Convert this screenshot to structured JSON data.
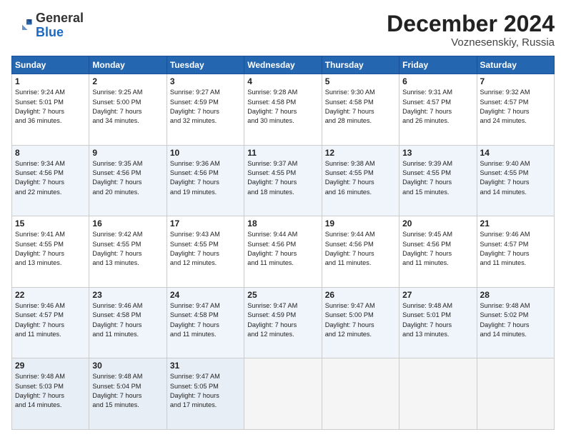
{
  "header": {
    "logo": {
      "general": "General",
      "blue": "Blue"
    },
    "title": "December 2024",
    "subtitle": "Voznesenskiy, Russia"
  },
  "weekdays": [
    "Sunday",
    "Monday",
    "Tuesday",
    "Wednesday",
    "Thursday",
    "Friday",
    "Saturday"
  ],
  "weeks": [
    [
      {
        "day": "1",
        "sunrise": "9:24 AM",
        "sunset": "5:01 PM",
        "daylight": "7 hours and 36 minutes."
      },
      {
        "day": "2",
        "sunrise": "9:25 AM",
        "sunset": "5:00 PM",
        "daylight": "7 hours and 34 minutes."
      },
      {
        "day": "3",
        "sunrise": "9:27 AM",
        "sunset": "4:59 PM",
        "daylight": "7 hours and 32 minutes."
      },
      {
        "day": "4",
        "sunrise": "9:28 AM",
        "sunset": "4:58 PM",
        "daylight": "7 hours and 30 minutes."
      },
      {
        "day": "5",
        "sunrise": "9:30 AM",
        "sunset": "4:58 PM",
        "daylight": "7 hours and 28 minutes."
      },
      {
        "day": "6",
        "sunrise": "9:31 AM",
        "sunset": "4:57 PM",
        "daylight": "7 hours and 26 minutes."
      },
      {
        "day": "7",
        "sunrise": "9:32 AM",
        "sunset": "4:57 PM",
        "daylight": "7 hours and 24 minutes."
      }
    ],
    [
      {
        "day": "8",
        "sunrise": "9:34 AM",
        "sunset": "4:56 PM",
        "daylight": "7 hours and 22 minutes."
      },
      {
        "day": "9",
        "sunrise": "9:35 AM",
        "sunset": "4:56 PM",
        "daylight": "7 hours and 20 minutes."
      },
      {
        "day": "10",
        "sunrise": "9:36 AM",
        "sunset": "4:56 PM",
        "daylight": "7 hours and 19 minutes."
      },
      {
        "day": "11",
        "sunrise": "9:37 AM",
        "sunset": "4:55 PM",
        "daylight": "7 hours and 18 minutes."
      },
      {
        "day": "12",
        "sunrise": "9:38 AM",
        "sunset": "4:55 PM",
        "daylight": "7 hours and 16 minutes."
      },
      {
        "day": "13",
        "sunrise": "9:39 AM",
        "sunset": "4:55 PM",
        "daylight": "7 hours and 15 minutes."
      },
      {
        "day": "14",
        "sunrise": "9:40 AM",
        "sunset": "4:55 PM",
        "daylight": "7 hours and 14 minutes."
      }
    ],
    [
      {
        "day": "15",
        "sunrise": "9:41 AM",
        "sunset": "4:55 PM",
        "daylight": "7 hours and 13 minutes."
      },
      {
        "day": "16",
        "sunrise": "9:42 AM",
        "sunset": "4:55 PM",
        "daylight": "7 hours and 13 minutes."
      },
      {
        "day": "17",
        "sunrise": "9:43 AM",
        "sunset": "4:55 PM",
        "daylight": "7 hours and 12 minutes."
      },
      {
        "day": "18",
        "sunrise": "9:44 AM",
        "sunset": "4:56 PM",
        "daylight": "7 hours and 11 minutes."
      },
      {
        "day": "19",
        "sunrise": "9:44 AM",
        "sunset": "4:56 PM",
        "daylight": "7 hours and 11 minutes."
      },
      {
        "day": "20",
        "sunrise": "9:45 AM",
        "sunset": "4:56 PM",
        "daylight": "7 hours and 11 minutes."
      },
      {
        "day": "21",
        "sunrise": "9:46 AM",
        "sunset": "4:57 PM",
        "daylight": "7 hours and 11 minutes."
      }
    ],
    [
      {
        "day": "22",
        "sunrise": "9:46 AM",
        "sunset": "4:57 PM",
        "daylight": "7 hours and 11 minutes."
      },
      {
        "day": "23",
        "sunrise": "9:46 AM",
        "sunset": "4:58 PM",
        "daylight": "7 hours and 11 minutes."
      },
      {
        "day": "24",
        "sunrise": "9:47 AM",
        "sunset": "4:58 PM",
        "daylight": "7 hours and 11 minutes."
      },
      {
        "day": "25",
        "sunrise": "9:47 AM",
        "sunset": "4:59 PM",
        "daylight": "7 hours and 12 minutes."
      },
      {
        "day": "26",
        "sunrise": "9:47 AM",
        "sunset": "5:00 PM",
        "daylight": "7 hours and 12 minutes."
      },
      {
        "day": "27",
        "sunrise": "9:48 AM",
        "sunset": "5:01 PM",
        "daylight": "7 hours and 13 minutes."
      },
      {
        "day": "28",
        "sunrise": "9:48 AM",
        "sunset": "5:02 PM",
        "daylight": "7 hours and 14 minutes."
      }
    ],
    [
      {
        "day": "29",
        "sunrise": "9:48 AM",
        "sunset": "5:03 PM",
        "daylight": "7 hours and 14 minutes."
      },
      {
        "day": "30",
        "sunrise": "9:48 AM",
        "sunset": "5:04 PM",
        "daylight": "7 hours and 15 minutes."
      },
      {
        "day": "31",
        "sunrise": "9:47 AM",
        "sunset": "5:05 PM",
        "daylight": "7 hours and 17 minutes."
      },
      null,
      null,
      null,
      null
    ]
  ],
  "labels": {
    "sunrise": "Sunrise:",
    "sunset": "Sunset:",
    "daylight": "Daylight hours"
  }
}
